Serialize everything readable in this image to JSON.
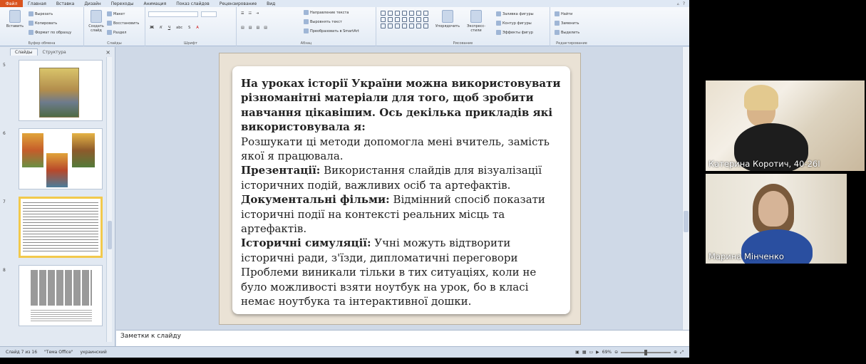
{
  "ribbon_tabs": {
    "file": "Файл",
    "items": [
      "Главная",
      "Вставка",
      "Дизайн",
      "Переходы",
      "Анимация",
      "Показ слайдов",
      "Рецензирование",
      "Вид"
    ]
  },
  "ribbon": {
    "paste_label": "Вставить",
    "cut_label": "Вырезать",
    "copy_label": "Копировать",
    "format_painter_label": "Формат по образцу",
    "clipboard_group": "Буфер обмена",
    "new_slide_label": "Создать слайд",
    "layout_label": "Макет",
    "reset_label": "Восстановить",
    "section_label": "Раздел",
    "slides_group": "Слайды",
    "font_group": "Шрифт",
    "text_direction_label": "Направление текста",
    "align_text_label": "Выровнять текст",
    "smartart_label": "Преобразовать в SmartArt",
    "paragraph_group": "Абзац",
    "arrange_label": "Упорядочить",
    "quick_styles_label": "Экспресс-стили",
    "shape_fill_label": "Заливка фигуры",
    "shape_outline_label": "Контур фигуры",
    "shape_effects_label": "Эффекты фигур",
    "drawing_group": "Рисование",
    "find_label": "Найти",
    "replace_label": "Заменить",
    "select_label": "Выделить",
    "editing_group": "Редактирование"
  },
  "left_panel": {
    "tab_slides": "Слайды",
    "tab_outline": "Структура",
    "close_glyph": "×",
    "slide_numbers": [
      "5",
      "6",
      "7",
      "8"
    ]
  },
  "slide": {
    "para1": "На уроках історії України можна використовувати різноманітні матеріали для того, щоб зробити навчання цікавішим. Ось декілька прикладів які використовувала я:",
    "para2": "Розшукати ці методи допомогла мені вчитель, замість якої я працювала.",
    "pres_label": "Презентації:",
    "pres_text": " Використання слайдів для візуалізації історичних подій, важливих осіб та артефактів.",
    "doc_label": "Документальні фільми:",
    "doc_text": " Відмінний спосіб показати історичні події на контексті реальних місць та артефактів.",
    "sim_label": "Історичні симуляції:",
    "sim_text": " Учні можуть відтворити історичні ради, з'їзди, дипломатичні переговори",
    "para_last": "Проблеми виникали тільки в тих ситуаціях, коли не було можливості взяти ноутбук на урок, бо в класі немає ноутбука та інтерактивної дошки."
  },
  "notes": {
    "placeholder": "Заметки к слайду"
  },
  "status": {
    "slide_info": "Слайд 7 из 16",
    "theme": "\"Тема Office\"",
    "language": "украинский",
    "zoom": "69%"
  },
  "participants": [
    {
      "name": "Катерина Коротич, 40-26І"
    },
    {
      "name": "Марина Мінченко"
    }
  ],
  "colors": {
    "file_tab": "#d9531e",
    "ribbon_bg": "#e3ebf5",
    "selected_thumb": "#f2c94c"
  }
}
